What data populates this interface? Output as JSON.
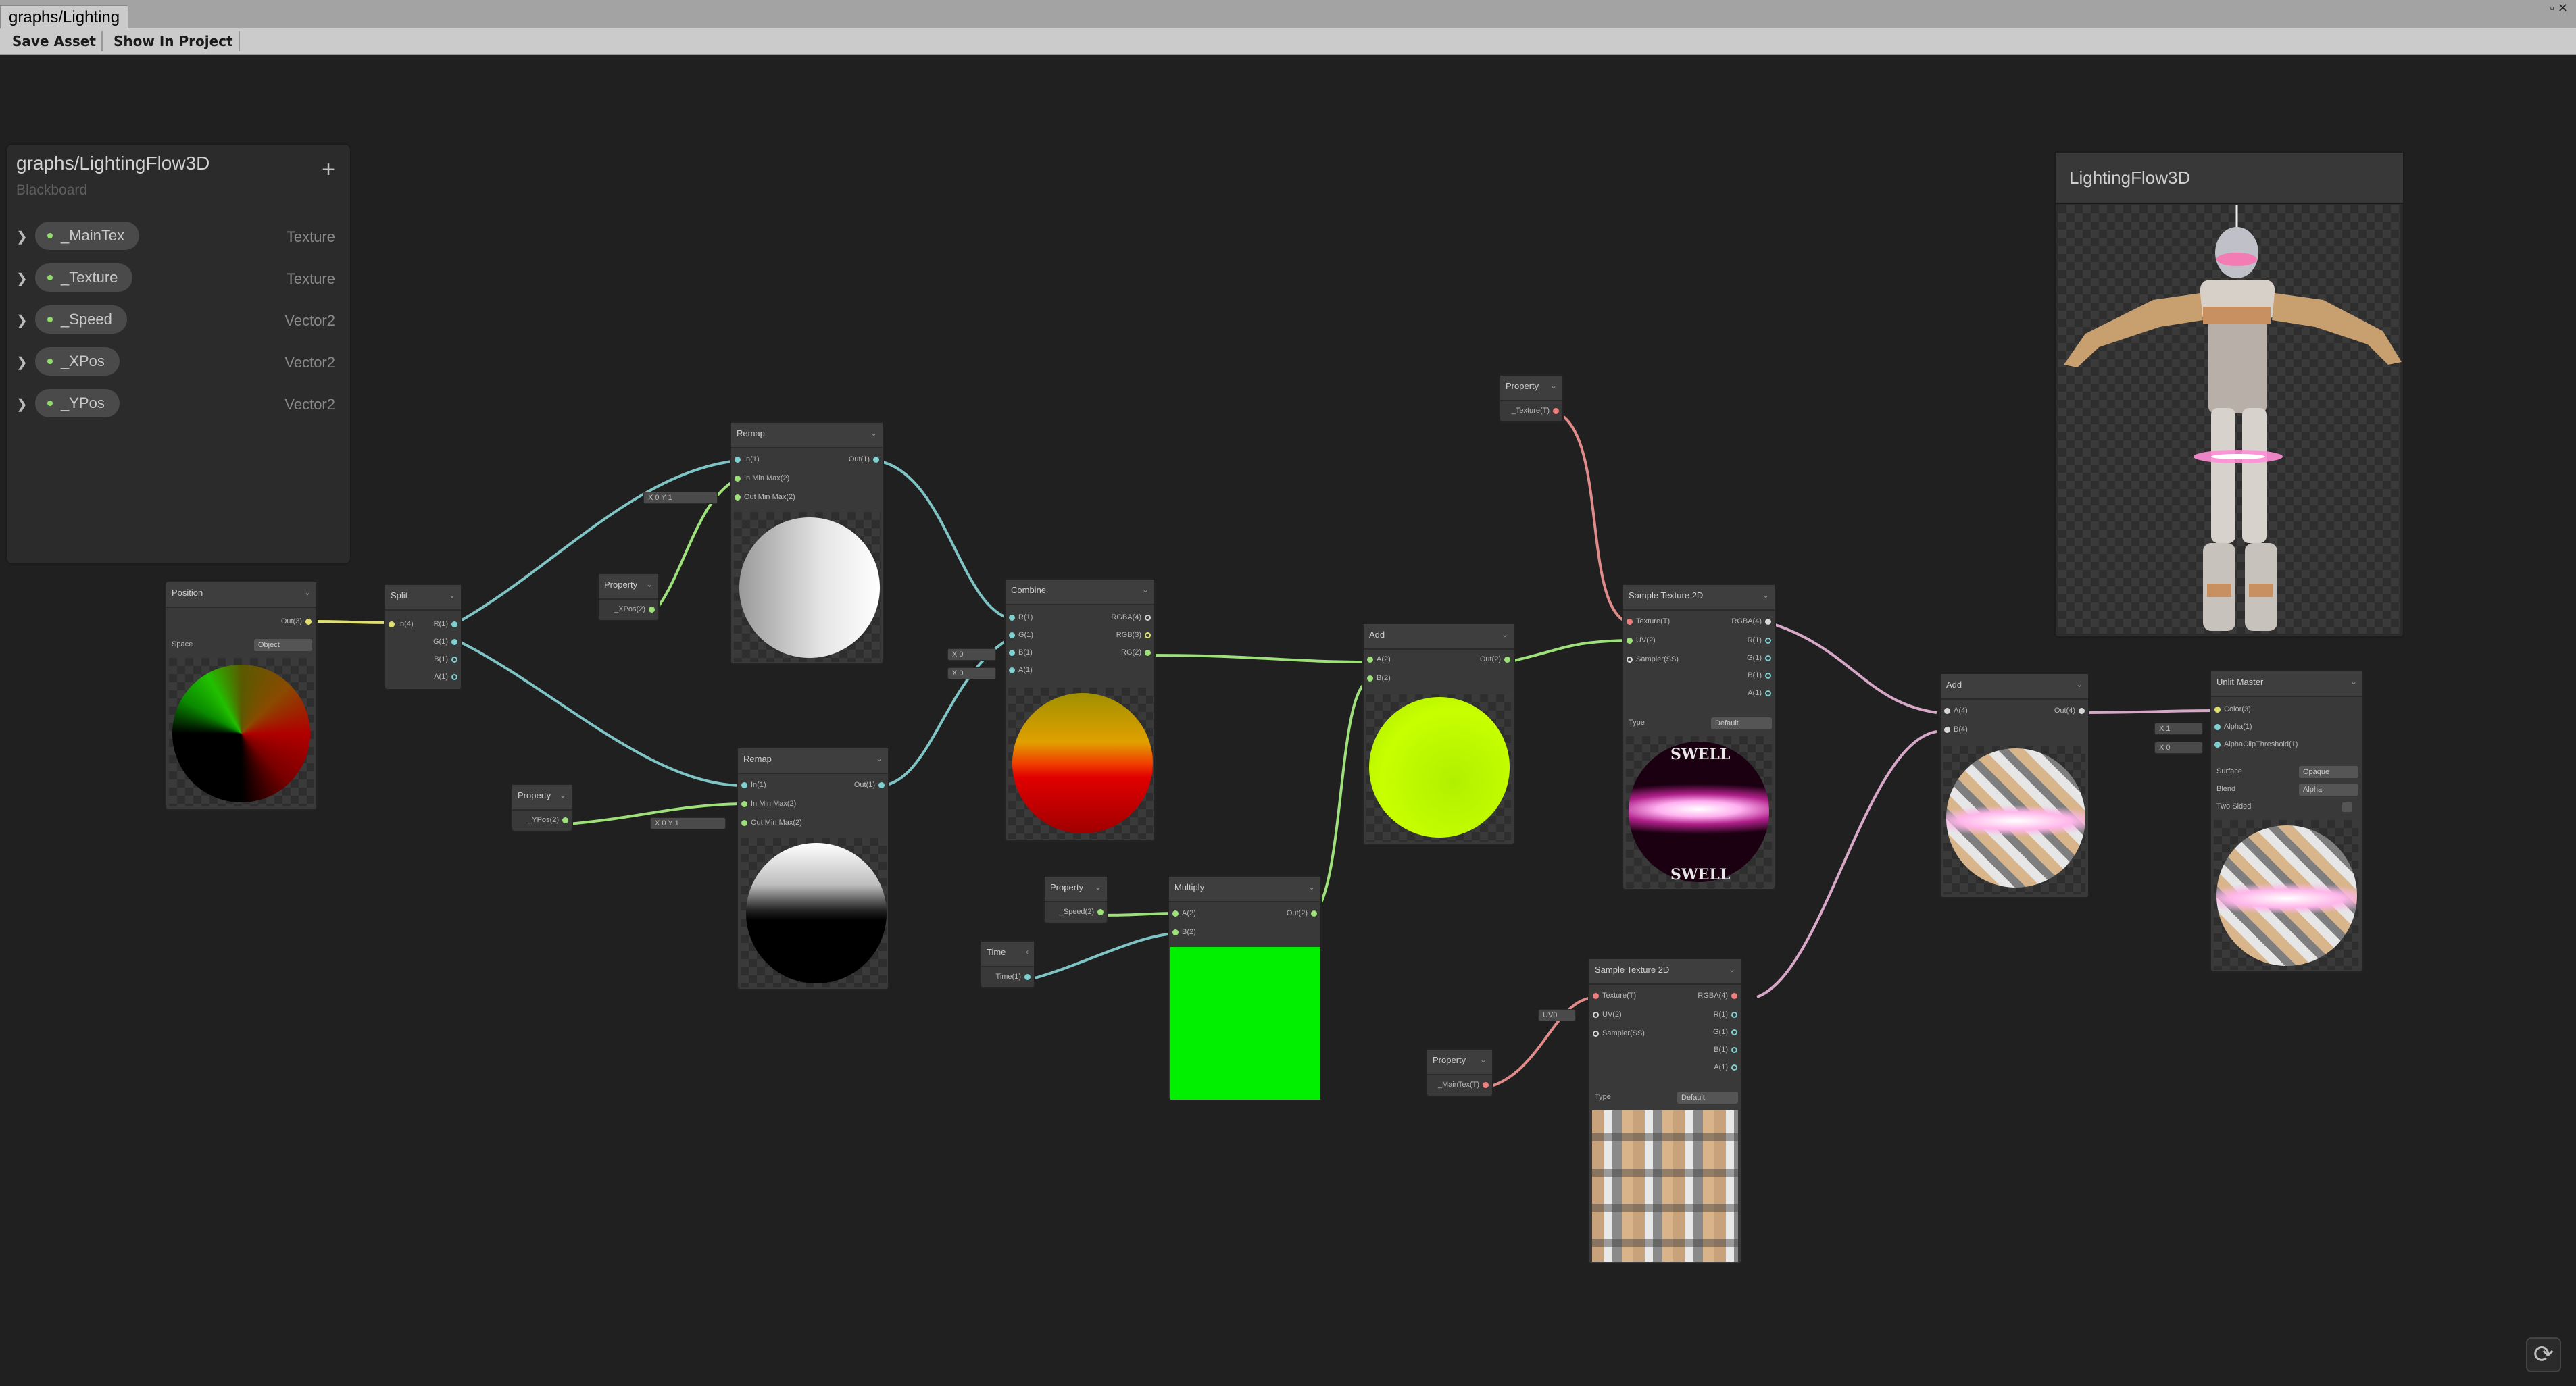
{
  "window": {
    "tab_title": "graphs/Lighting",
    "win_controls": "▫ ✕"
  },
  "toolbar": {
    "save_asset": "Save Asset",
    "show_in_project": "Show In Project"
  },
  "blackboard": {
    "title": "graphs/LightingFlow3D",
    "subtitle": "Blackboard",
    "add": "+",
    "properties": [
      {
        "name": "_MainTex",
        "type": "Texture"
      },
      {
        "name": "_Texture",
        "type": "Texture"
      },
      {
        "name": "_Speed",
        "type": "Vector2"
      },
      {
        "name": "_XPos",
        "type": "Vector2"
      },
      {
        "name": "_YPos",
        "type": "Vector2"
      }
    ]
  },
  "nodes": {
    "position": {
      "title": "Position",
      "out": "Out(3)",
      "space_label": "Space",
      "space_value": "Object"
    },
    "split": {
      "title": "Split",
      "in": "In(4)",
      "outs": [
        "R(1)",
        "G(1)",
        "B(1)",
        "A(1)"
      ]
    },
    "remap_top": {
      "title": "Remap",
      "ins": [
        "In(1)",
        "In Min Max(2)",
        "Out Min Max(2)"
      ],
      "out": "Out(1)",
      "field": "X 0   Y 1"
    },
    "prop_xpos": {
      "title": "Property",
      "out": "_XPos(2)"
    },
    "remap_bottom": {
      "title": "Remap",
      "ins": [
        "In(1)",
        "In Min Max(2)",
        "Out Min Max(2)"
      ],
      "out": "Out(1)",
      "field": "X 0   Y 1"
    },
    "prop_ypos": {
      "title": "Property",
      "out": "_YPos(2)"
    },
    "combine": {
      "title": "Combine",
      "ins": [
        "R(1)",
        "G(1)",
        "B(1)",
        "A(1)"
      ],
      "outs": [
        "RGBA(4)",
        "RGB(3)",
        "RG(2)"
      ],
      "field_b": "X 0",
      "field_a": "X 0"
    },
    "prop_speed": {
      "title": "Property",
      "out": "_Speed(2)"
    },
    "time": {
      "title": "Time",
      "out": "Time(1)"
    },
    "multiply": {
      "title": "Multiply",
      "ins": [
        "A(2)",
        "B(2)"
      ],
      "out": "Out(2)"
    },
    "add1": {
      "title": "Add",
      "ins": [
        "A(2)",
        "B(2)"
      ],
      "out": "Out(2)"
    },
    "prop_texture": {
      "title": "Property",
      "out": "_Texture(T)"
    },
    "sample1": {
      "title": "Sample Texture 2D",
      "ins": [
        "Texture(T)",
        "UV(2)",
        "Sampler(SS)"
      ],
      "outs": [
        "RGBA(4)",
        "R(1)",
        "G(1)",
        "B(1)",
        "A(1)"
      ],
      "type_label": "Type",
      "type_value": "Default"
    },
    "sample2": {
      "title": "Sample Texture 2D",
      "ins": [
        "Texture(T)",
        "UV(2)",
        "Sampler(SS)"
      ],
      "outs": [
        "RGBA(4)",
        "R(1)",
        "G(1)",
        "B(1)",
        "A(1)"
      ],
      "type_label": "Type",
      "type_value": "Default",
      "uv_field": "UV0"
    },
    "prop_maintex": {
      "title": "Property",
      "out": "_MainTex(T)"
    },
    "add2": {
      "title": "Add",
      "ins": [
        "A(4)",
        "B(4)"
      ],
      "out": "Out(4)"
    },
    "unlit": {
      "title": "Unlit Master",
      "ins": [
        "Color(3)",
        "Alpha(1)",
        "AlphaClipThreshold(1)"
      ],
      "surface_label": "Surface",
      "surface_value": "Opaque",
      "blend_label": "Blend",
      "blend_value": "Alpha",
      "twosided_label": "Two Sided",
      "field_alpha": "X 1",
      "field_clip": "X 0"
    }
  },
  "main_preview": {
    "title": "LightingFlow3D"
  },
  "sample_text": {
    "top": "SWELL",
    "bottom": "SWELL"
  }
}
